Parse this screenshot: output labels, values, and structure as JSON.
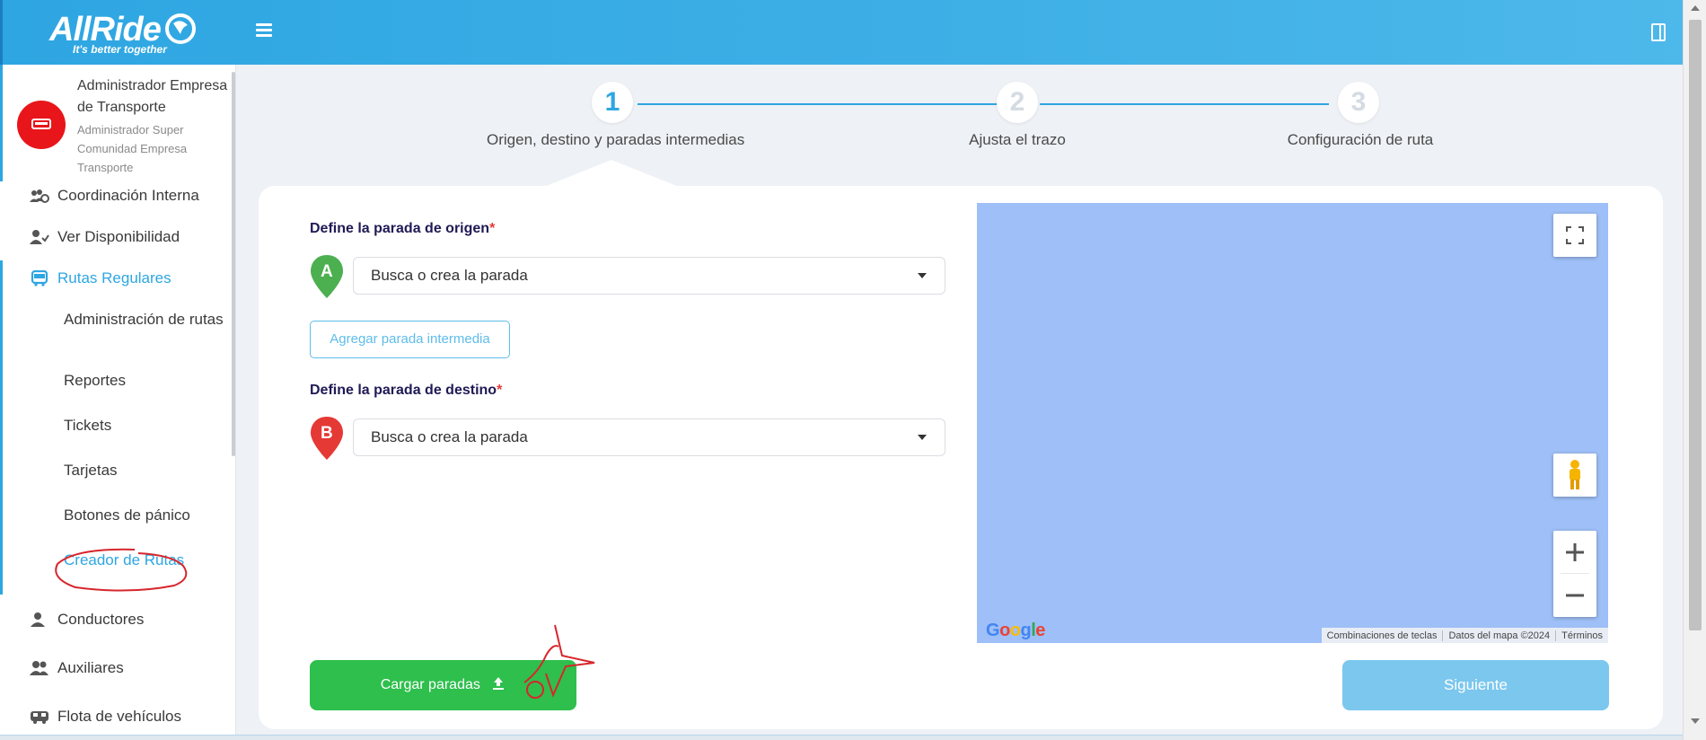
{
  "header": {
    "logo_text": "AllRide",
    "logo_tagline": "It's better together"
  },
  "user": {
    "name": "Administrador Empresa de Transporte",
    "role": "Administrador Super Comunidad Empresa Transporte"
  },
  "sidebar": {
    "items": [
      {
        "label": "Coordinación Interna"
      },
      {
        "label": "Ver Disponibilidad"
      },
      {
        "label": "Rutas Regulares"
      },
      {
        "label": "Conductores"
      },
      {
        "label": "Auxiliares"
      },
      {
        "label": "Flota de vehículos"
      }
    ],
    "rutas_sub": [
      {
        "label": "Administración de rutas"
      },
      {
        "label": "Reportes"
      },
      {
        "label": "Tickets"
      },
      {
        "label": "Tarjetas"
      },
      {
        "label": "Botones de pánico"
      },
      {
        "label": "Creador de Rutas"
      }
    ]
  },
  "stepper": {
    "steps": [
      {
        "number": "1",
        "label": "Origen, destino y paradas intermedias"
      },
      {
        "number": "2",
        "label": "Ajusta el trazo"
      },
      {
        "number": "3",
        "label": "Configuración de ruta"
      }
    ]
  },
  "form": {
    "origin_label": "Define la parada de origen",
    "origin_pin": "A",
    "origin_value": "Busca o crea la parada",
    "add_stop_label": "Agregar parada intermedia",
    "dest_label": "Define la parada de destino",
    "dest_pin": "B",
    "dest_value": "Busca o crea la parada",
    "required_mark": "*",
    "upload_label": "Cargar paradas",
    "next_label": "Siguiente"
  },
  "map": {
    "google_logo": "Google",
    "attribution": [
      "Combinaciones de teclas",
      "Datos del mapa ©2024",
      "Términos"
    ]
  },
  "colors": {
    "primary": "#2ea6e2",
    "green": "#2ebf4d",
    "pin_a": "#4caf50",
    "pin_b": "#e53935",
    "map_water": "#9ebff7"
  }
}
